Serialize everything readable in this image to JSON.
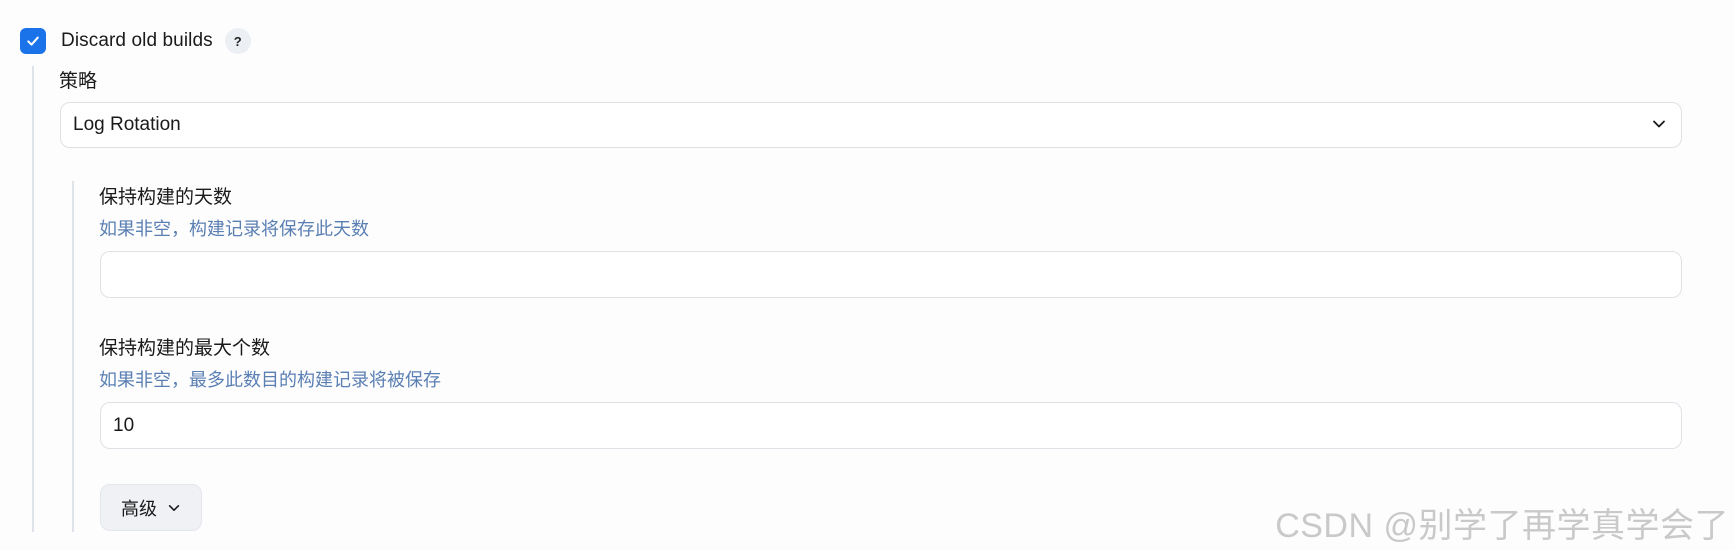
{
  "discard_old_builds": {
    "checked": true,
    "label": "Discard old builds",
    "help_icon_text": "?"
  },
  "strategy": {
    "label": "策略",
    "selected_value": "Log Rotation",
    "icon": "chevron-down-icon"
  },
  "days_to_keep": {
    "label": "保持构建的天数",
    "description": "如果非空，构建记录将保存此天数",
    "value": ""
  },
  "max_builds": {
    "label": "保持构建的最大个数",
    "description": "如果非空，最多此数目的构建记录将被保存",
    "value": "10"
  },
  "advanced": {
    "label": "高级",
    "icon": "chevron-down-icon"
  },
  "watermark": "CSDN @别学了再学真学会了",
  "colors": {
    "accent": "#1a73e8",
    "description_text": "#5a7fb3",
    "border": "#dfe1e6"
  }
}
